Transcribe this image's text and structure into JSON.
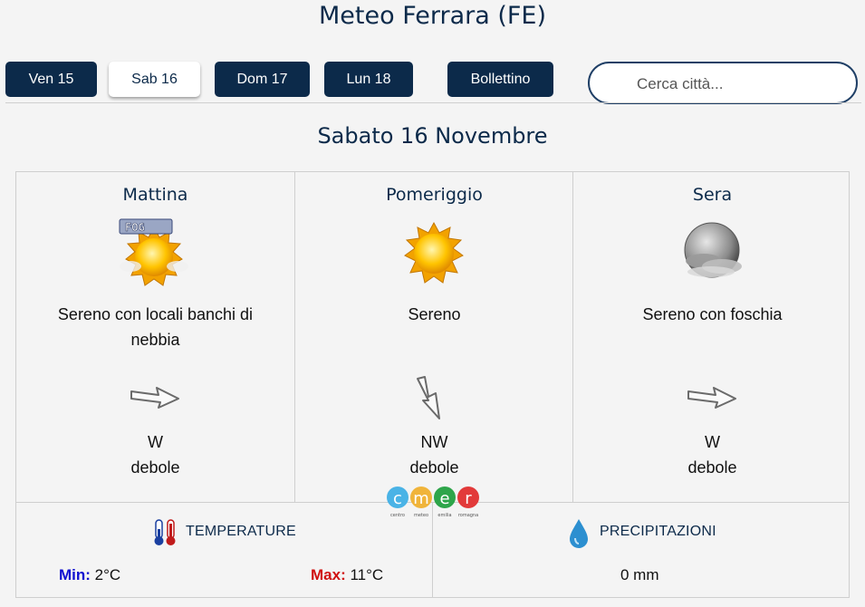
{
  "page": {
    "title": "Meteo Ferrara (FE)"
  },
  "tabs": [
    {
      "label": "Ven 15",
      "active": false
    },
    {
      "label": "Sab 16",
      "active": true
    },
    {
      "label": "Dom 17",
      "active": false
    },
    {
      "label": "Lun 18",
      "active": false
    },
    {
      "label": "Bollettino",
      "active": false
    }
  ],
  "search": {
    "placeholder": "Cerca città...",
    "value": ""
  },
  "day": {
    "heading": "Sabato 16 Novembre"
  },
  "periods": [
    {
      "name": "Mattina",
      "icon": "sun-fog-icon",
      "fog_badge": "FOG",
      "description": "Sereno con locali banchi di nebbia",
      "wind_icon": "wind-arrow-east-icon",
      "wind_direction": "W",
      "wind_strength": "debole"
    },
    {
      "name": "Pomeriggio",
      "icon": "sun-icon",
      "description": "Sereno",
      "wind_icon": "wind-arrow-southeast-icon",
      "wind_direction": "NW",
      "wind_strength": "debole"
    },
    {
      "name": "Sera",
      "icon": "haze-night-icon",
      "description": "Sereno con foschia",
      "wind_icon": "wind-arrow-east-icon",
      "wind_direction": "W",
      "wind_strength": "debole"
    }
  ],
  "temperature": {
    "label": "TEMPERATURE",
    "min_label": "Min:",
    "min_value": "2°C",
    "max_label": "Max:",
    "max_value": "11°C"
  },
  "precipitation": {
    "label": "PRECIPITAZIONI",
    "value": "0 mm"
  },
  "logo": {
    "letters": [
      "c",
      "m",
      "e",
      "r"
    ],
    "captions": [
      "centro",
      "meteo",
      "emilia",
      "romagna"
    ]
  },
  "colors": {
    "primary": "#0c2a4a",
    "min": "#1010d0",
    "max": "#d01010",
    "background": "#f4f4f4"
  }
}
